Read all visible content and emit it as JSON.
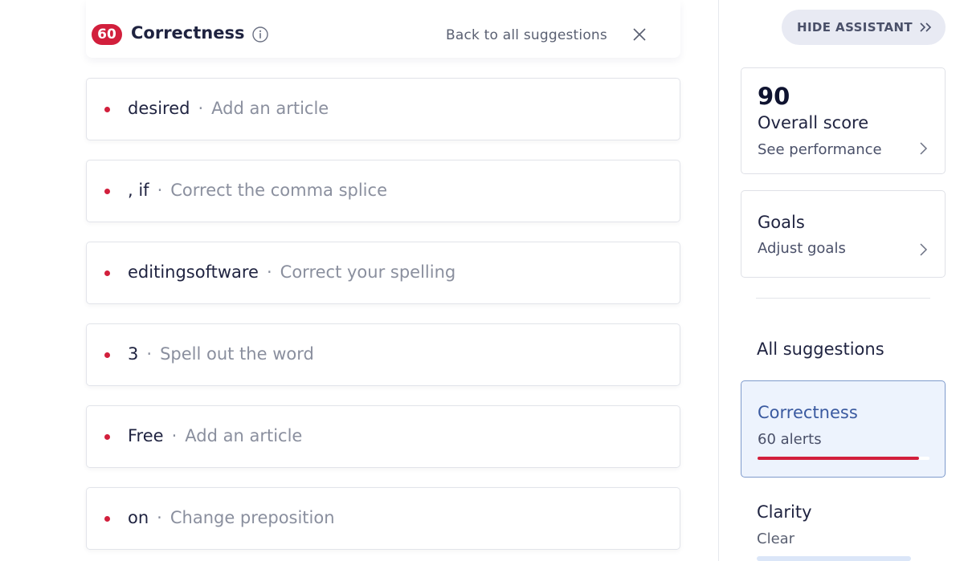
{
  "category_header": {
    "count": "60",
    "title": "Correctness",
    "back_link": "Back to all suggestions"
  },
  "suggestions": [
    {
      "word": "desired",
      "hint": "Add an article"
    },
    {
      "word": ", if",
      "hint": "Correct the comma splice"
    },
    {
      "word": "editingsoftware",
      "hint": "Correct your spelling"
    },
    {
      "word": "3",
      "hint": "Spell out the word"
    },
    {
      "word": "Free",
      "hint": "Add an article"
    },
    {
      "word": "on",
      "hint": "Change preposition"
    }
  ],
  "separator": "·",
  "sidebar": {
    "hide_button": "HIDE ASSISTANT",
    "score": {
      "value": "90",
      "label": "Overall score",
      "link": "See performance"
    },
    "goals": {
      "title": "Goals",
      "link": "Adjust goals"
    },
    "all_suggestions": "All suggestions",
    "categories": [
      {
        "name": "Correctness",
        "status": "60 alerts",
        "progress": 0.94,
        "color": "#d21f3c",
        "active": true
      },
      {
        "name": "Clarity",
        "status": "Clear",
        "color": "#dbe6f8",
        "active": false
      }
    ]
  },
  "colors": {
    "accent_red": "#d21f3c",
    "active_blue": "#3a5aa0",
    "active_bg": "#edf3fd"
  },
  "icons": [
    "info-icon",
    "close-icon",
    "double-chevron-right-icon",
    "chevron-right-icon"
  ]
}
